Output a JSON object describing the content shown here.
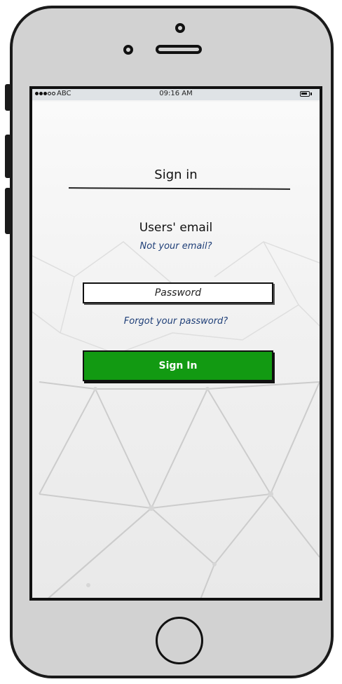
{
  "status_bar": {
    "carrier": "ABC",
    "time": "09:16 AM",
    "signal_filled": 3,
    "signal_total": 5
  },
  "screen": {
    "title": "Sign in",
    "email_label": "Users' email",
    "not_email_link": "Not your email?",
    "password_placeholder": "Password",
    "password_value": "",
    "forgot_password_link": "Forgot your password?",
    "sign_in_button": "Sign In"
  },
  "icons": {
    "battery": "battery-icon",
    "signal": "signal-strength-icon",
    "home": "home-button-icon"
  },
  "colors": {
    "primary_button": "#129a12",
    "link": "#1f3f78",
    "phone_body": "#d2d2d2",
    "status_bar_bg": "#dfe3e6"
  }
}
